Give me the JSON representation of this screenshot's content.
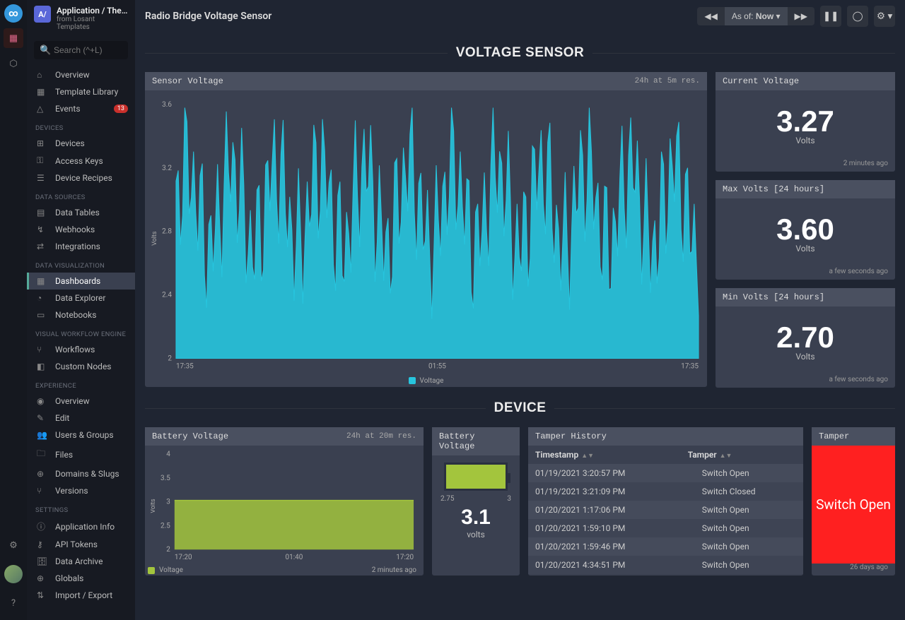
{
  "app": {
    "badge": "A/",
    "title": "Application / The Thin…",
    "subtitle": "from Losant Templates"
  },
  "search": {
    "placeholder": "Search (^+L)"
  },
  "nav": {
    "top": [
      {
        "icon": "⌂",
        "label": "Overview"
      },
      {
        "icon": "▦",
        "label": "Template Library"
      },
      {
        "icon": "△",
        "label": "Events",
        "badge": "13"
      }
    ],
    "groups": [
      {
        "title": "DEVICES",
        "items": [
          {
            "icon": "⊞",
            "label": "Devices"
          },
          {
            "icon": "⚿",
            "label": "Access Keys"
          },
          {
            "icon": "☰",
            "label": "Device Recipes"
          }
        ]
      },
      {
        "title": "DATA SOURCES",
        "items": [
          {
            "icon": "▤",
            "label": "Data Tables"
          },
          {
            "icon": "↯",
            "label": "Webhooks"
          },
          {
            "icon": "⇄",
            "label": "Integrations"
          }
        ]
      },
      {
        "title": "DATA VISUALIZATION",
        "items": [
          {
            "icon": "▦",
            "label": "Dashboards",
            "active": true
          },
          {
            "icon": "◔",
            "label": "Data Explorer"
          },
          {
            "icon": "▭",
            "label": "Notebooks"
          }
        ]
      },
      {
        "title": "VISUAL WORKFLOW ENGINE",
        "items": [
          {
            "icon": "⑂",
            "label": "Workflows"
          },
          {
            "icon": "◧",
            "label": "Custom Nodes"
          }
        ]
      },
      {
        "title": "EXPERIENCE",
        "items": [
          {
            "icon": "◉",
            "label": "Overview"
          },
          {
            "icon": "✎",
            "label": "Edit"
          },
          {
            "icon": "👥",
            "label": "Users & Groups"
          },
          {
            "icon": "🗀",
            "label": "Files"
          },
          {
            "icon": "⊕",
            "label": "Domains & Slugs"
          },
          {
            "icon": "⑂",
            "label": "Versions"
          }
        ]
      },
      {
        "title": "SETTINGS",
        "items": [
          {
            "icon": "ⓘ",
            "label": "Application Info"
          },
          {
            "icon": "⚷",
            "label": "API Tokens"
          },
          {
            "icon": "🗄",
            "label": "Data Archive"
          },
          {
            "icon": "⊕",
            "label": "Globals"
          },
          {
            "icon": "⇅",
            "label": "Import / Export"
          }
        ]
      }
    ]
  },
  "page": {
    "title": "Radio Bridge Voltage Sensor"
  },
  "topbar": {
    "asof_prefix": "As of: ",
    "asof_value": "Now"
  },
  "sections": {
    "voltage": "VOLTAGE SENSOR",
    "device": "DEVICE"
  },
  "panels": {
    "sensor_voltage": {
      "title": "Sensor Voltage",
      "meta": "24h at 5m res.",
      "legend": "Voltage",
      "y_ticks": [
        "3.6",
        "3.2",
        "2.8",
        "2.4",
        "2"
      ],
      "y_label": "Volts",
      "x_ticks": [
        "17:35",
        "01:55",
        "17:35"
      ]
    },
    "current": {
      "title": "Current Voltage",
      "value": "3.27",
      "unit": "Volts",
      "time": "2 minutes ago"
    },
    "max": {
      "title": "Max Volts [24 hours]",
      "value": "3.60",
      "unit": "Volts",
      "time": "a few seconds ago"
    },
    "min": {
      "title": "Min Volts [24 hours]",
      "value": "2.70",
      "unit": "Volts",
      "time": "a few seconds ago"
    },
    "battery_chart": {
      "title": "Battery Voltage",
      "meta": "24h at 20m res.",
      "legend": "Voltage",
      "y_ticks": [
        "4",
        "3.5",
        "3",
        "2.5",
        "2"
      ],
      "y_label": "Volts",
      "x_ticks": [
        "17:20",
        "01:40",
        "17:20"
      ],
      "time": "2 minutes ago"
    },
    "battery_gauge": {
      "title": "Battery Voltage",
      "min": "2.75",
      "max": "3",
      "value": "3.1",
      "unit": "volts"
    },
    "tamper_history": {
      "title": "Tamper History",
      "col1": "Timestamp",
      "col2": "Tamper",
      "rows": [
        {
          "t": "01/19/2021 3:20:57 PM",
          "v": "Switch Open"
        },
        {
          "t": "01/19/2021 3:21:09 PM",
          "v": "Switch Closed"
        },
        {
          "t": "01/20/2021 1:17:06 PM",
          "v": "Switch Open"
        },
        {
          "t": "01/20/2021 1:59:10 PM",
          "v": "Switch Open"
        },
        {
          "t": "01/20/2021 1:59:46 PM",
          "v": "Switch Open"
        },
        {
          "t": "01/20/2021 4:34:51 PM",
          "v": "Switch Open"
        }
      ]
    },
    "tamper": {
      "title": "Tamper",
      "value": "Switch Open",
      "time": "26 days ago"
    }
  },
  "chart_data": [
    {
      "type": "area",
      "title": "Sensor Voltage",
      "xlabel": "",
      "ylabel": "Volts",
      "ylim": [
        2,
        3.6
      ],
      "x": [
        "17:35",
        "01:55",
        "17:35"
      ],
      "series": [
        {
          "name": "Voltage",
          "color": "#27c5de",
          "note": "~288 points oscillating between ~2.3 and ~3.6 V over 24h at 5m resolution"
        }
      ]
    },
    {
      "type": "area",
      "title": "Battery Voltage",
      "xlabel": "",
      "ylabel": "Volts",
      "ylim": [
        2,
        4
      ],
      "x": [
        "17:20",
        "01:40",
        "17:20"
      ],
      "series": [
        {
          "name": "Voltage",
          "color": "#a3c53d",
          "values_flat": 3.0,
          "note": "flat at ~3.0 V over 24h at 20m resolution"
        }
      ]
    }
  ]
}
